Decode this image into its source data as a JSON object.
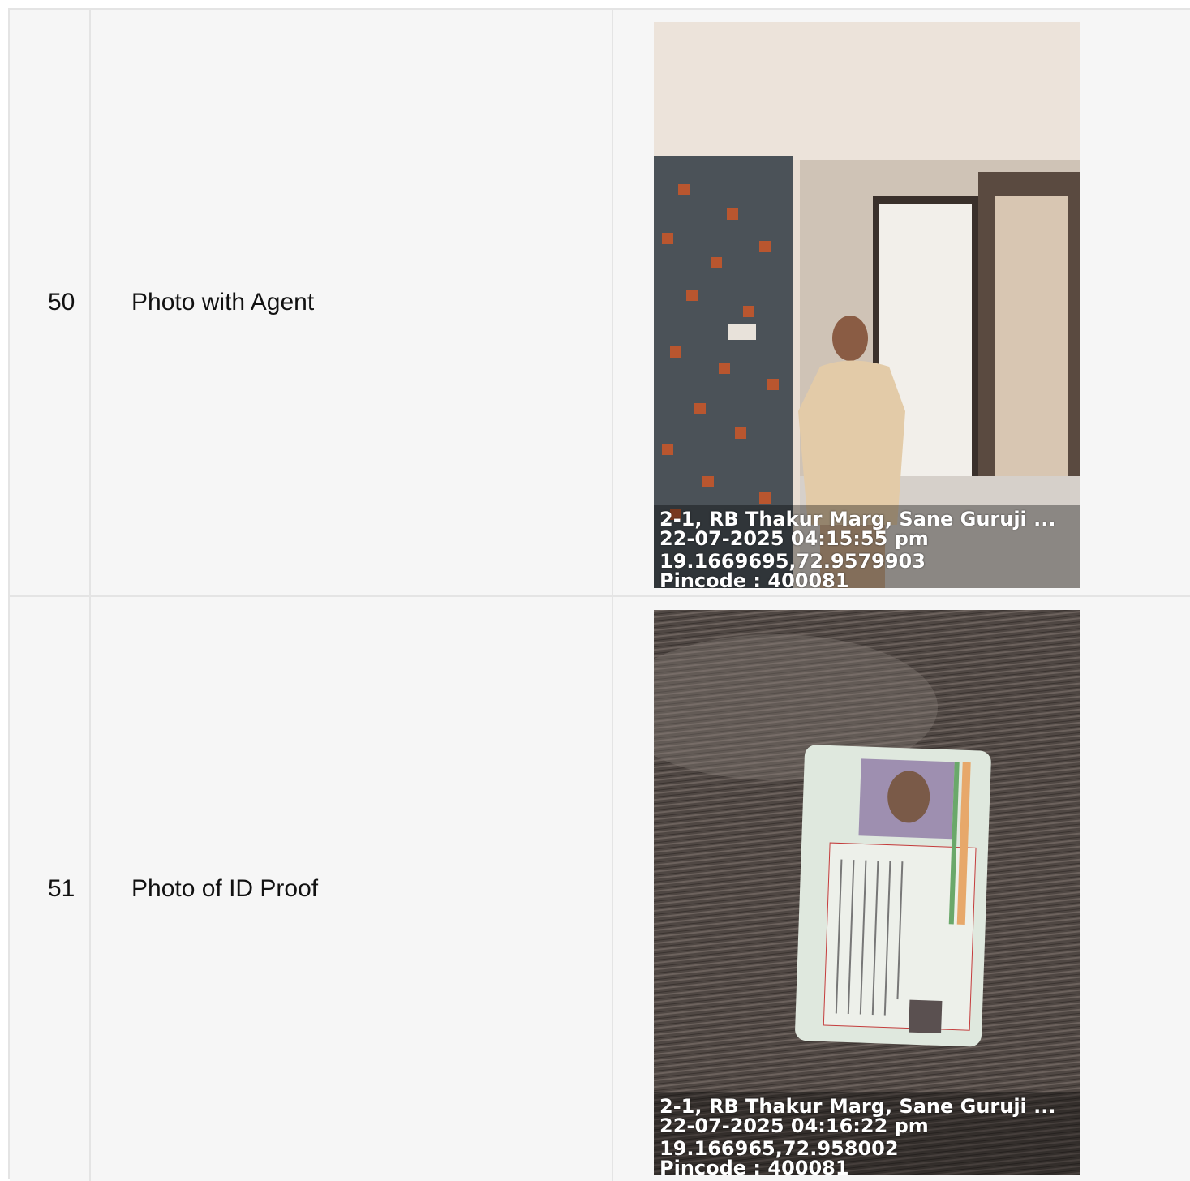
{
  "rows": [
    {
      "number": "50",
      "label": "Photo with Agent",
      "image": {
        "name": "agent-photo",
        "address": "2-1, RB Thakur Marg, Sane Guruji ...",
        "timestamp": "22-07-2025 04:15:55 pm",
        "coordinates": "19.1669695,72.9579903",
        "pincode": "Pincode : 400081"
      }
    },
    {
      "number": "51",
      "label": "Photo of ID Proof",
      "image": {
        "name": "id-proof-photo",
        "address": "2-1, RB Thakur Marg, Sane Guruji ...",
        "timestamp": "22-07-2025 04:16:22 pm",
        "coordinates": "19.166965,72.958002",
        "pincode": "Pincode : 400081"
      }
    }
  ]
}
